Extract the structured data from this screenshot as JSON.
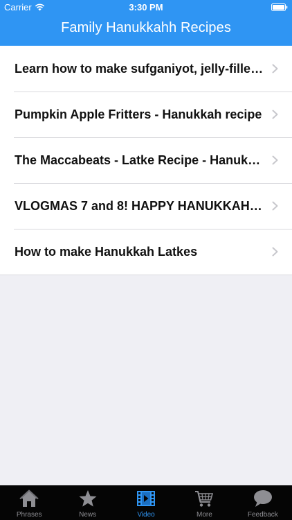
{
  "status_bar": {
    "carrier": "Carrier",
    "time": "3:30 PM"
  },
  "header": {
    "title": "Family Hanukkahh Recipes",
    "background_color": "#2f95f3"
  },
  "list": {
    "items": [
      {
        "label": "Learn how to make sufganiyot, jelly-filled doughnuts"
      },
      {
        "label": "Pumpkin Apple Fritters - Hanukkah recipe"
      },
      {
        "label": "The Maccabeats - Latke Recipe - Hanukkah"
      },
      {
        "label": "VLOGMAS 7 and 8! HAPPY HANUKKAH!..."
      },
      {
        "label": "How to make Hanukkah Latkes"
      }
    ]
  },
  "tabbar": {
    "active_color": "#2f95f3",
    "inactive_color": "#8e8e93",
    "tabs": [
      {
        "label": "Phrases",
        "icon": "house-icon"
      },
      {
        "label": "News",
        "icon": "star-icon"
      },
      {
        "label": "Video",
        "icon": "film-icon",
        "active": true
      },
      {
        "label": "More",
        "icon": "cart-icon"
      },
      {
        "label": "Feedback",
        "icon": "speech-bubble-icon"
      }
    ]
  }
}
